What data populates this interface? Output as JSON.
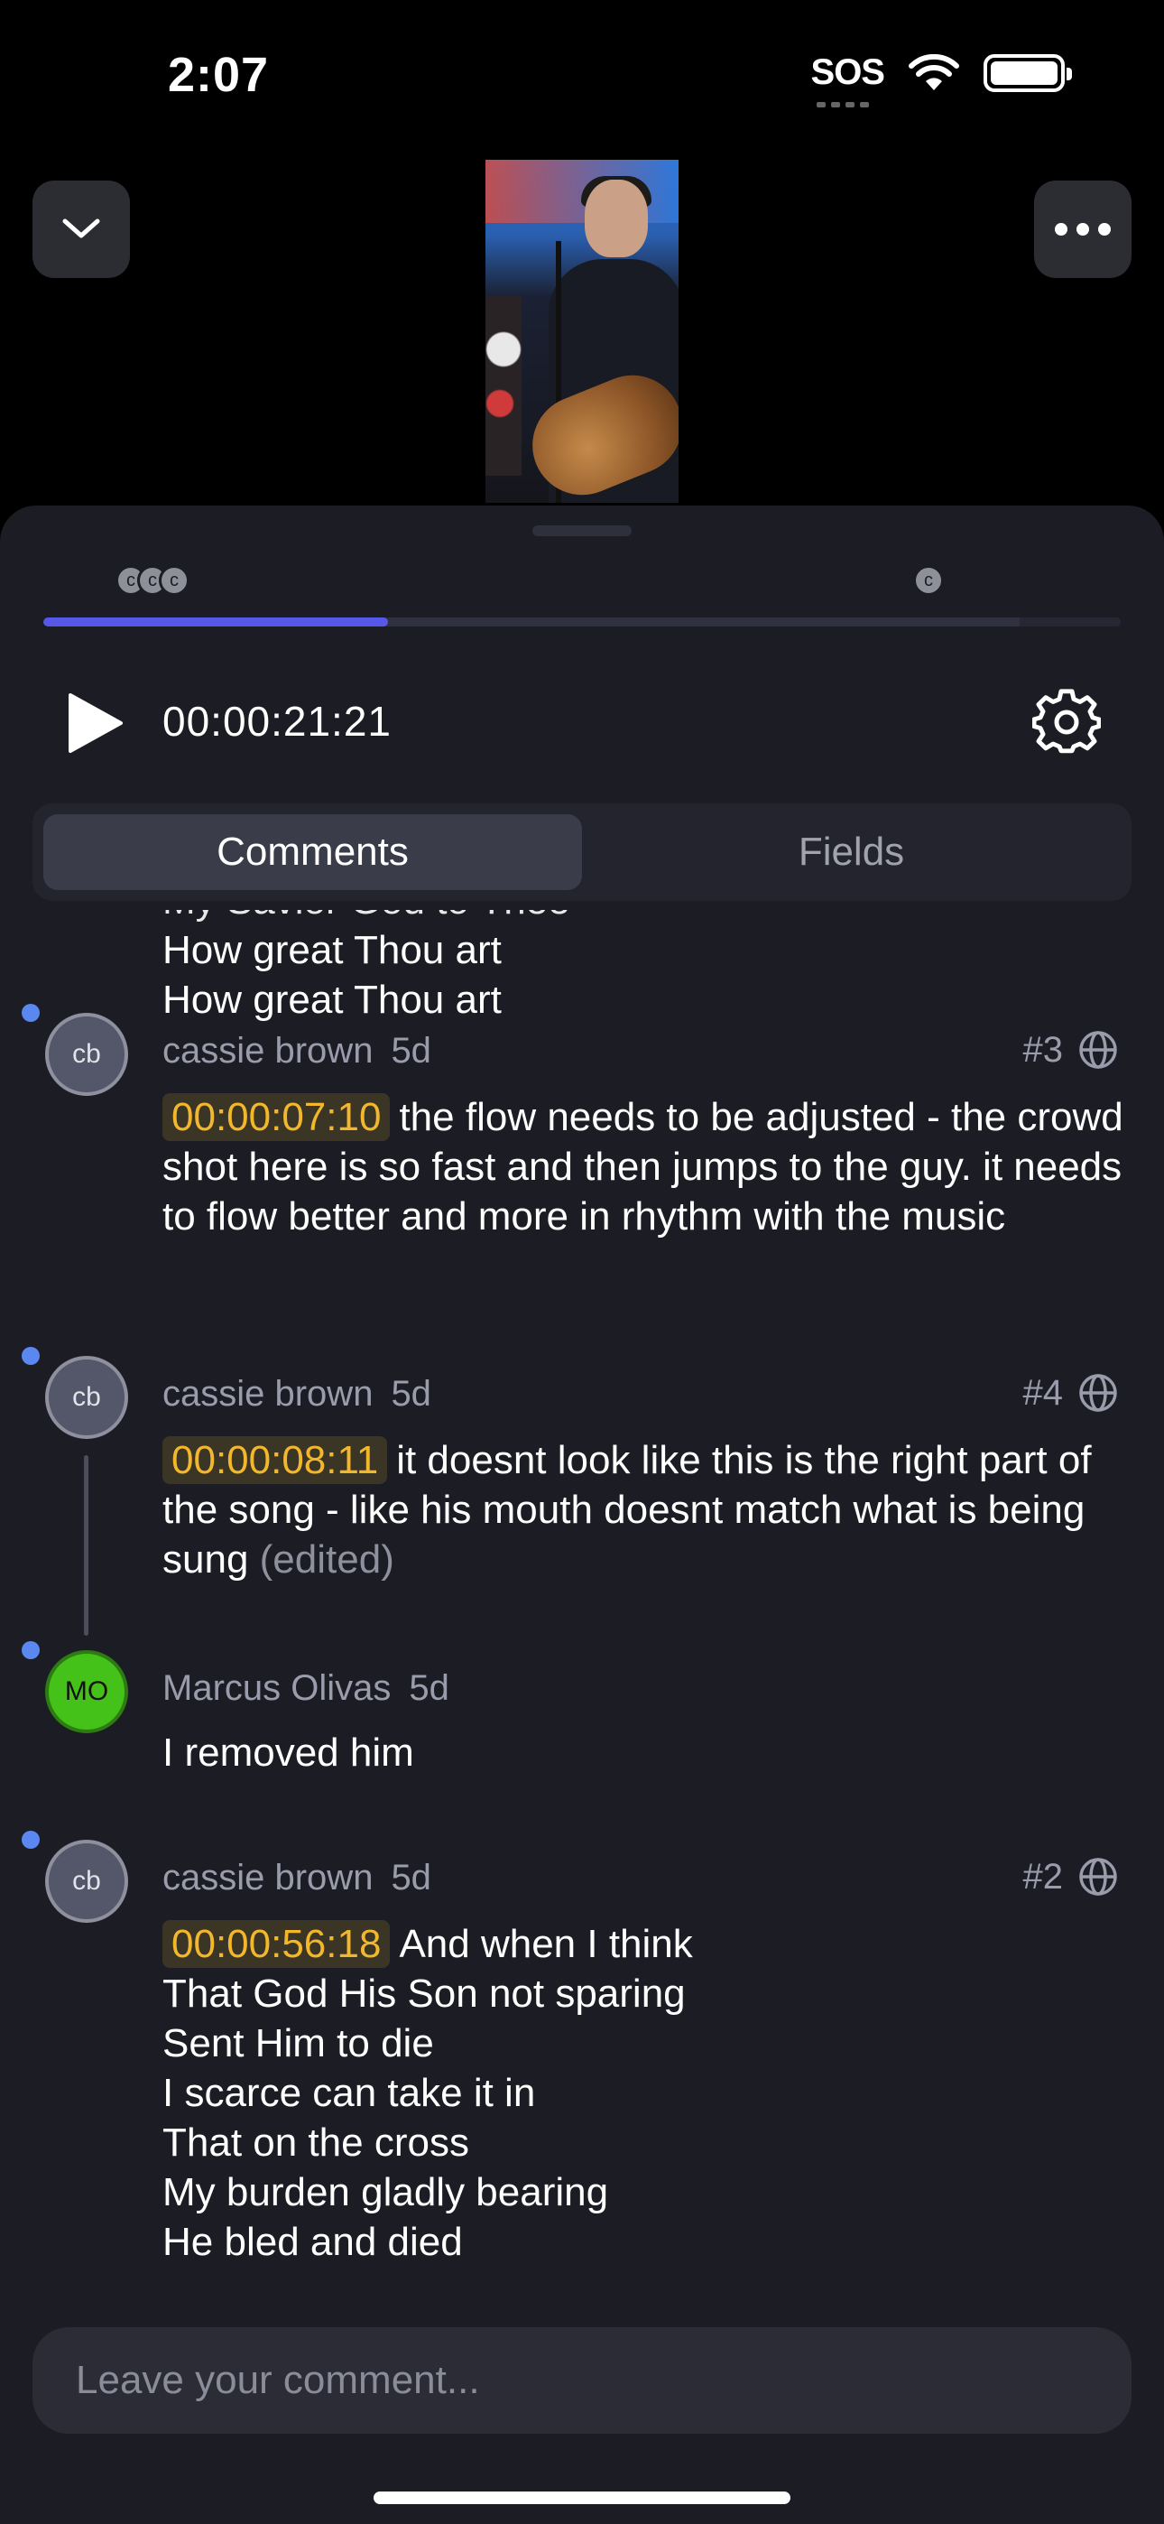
{
  "status": {
    "time": "2:07",
    "carrier": "SOS"
  },
  "player": {
    "timecode": "00:00:21:21",
    "progress": 0.32,
    "markers": [
      "c",
      "c",
      "c",
      "c"
    ]
  },
  "tabs": [
    {
      "label": "Comments",
      "active": true
    },
    {
      "label": "Fields",
      "active": false
    }
  ],
  "clipped_comment": {
    "partial_line": "My Savior God to Thee",
    "lines": [
      "How great Thou art",
      "How great Thou art"
    ]
  },
  "comments": [
    {
      "avatar": "cb",
      "author": "cassie brown",
      "ago": "5d",
      "ref": "#3",
      "timestamp": "00:00:07:10",
      "text": "the flow needs to be adjusted - the crowd shot here is so fast and then jumps to the guy. it needs to flow better and more in rhythm with the music",
      "edited": ""
    },
    {
      "avatar": "cb",
      "author": "cassie brown",
      "ago": "5d",
      "ref": "#4",
      "timestamp": "00:00:08:11",
      "text": "it doesnt look like this is the right part of the song - like his mouth doesnt match what is being sung",
      "edited": "(edited)"
    },
    {
      "avatar": "MO",
      "author": "Marcus Olivas",
      "ago": "5d",
      "text": "I removed him"
    },
    {
      "avatar": "cb",
      "author": "cassie brown",
      "ago": "5d",
      "ref": "#2",
      "timestamp": "00:00:56:18",
      "text": "And when I think",
      "lines": [
        "That God His Son not sparing",
        "Sent Him to die",
        "I scarce can take it in",
        "That on the cross",
        "My burden gladly bearing",
        "He bled and died"
      ]
    }
  ],
  "input": {
    "placeholder": "Leave your comment..."
  },
  "colors": {
    "accent": "#5757e8",
    "timestamp": "#f3b72c",
    "unread": "#5b88f0",
    "avatar_green": "#45c219"
  }
}
